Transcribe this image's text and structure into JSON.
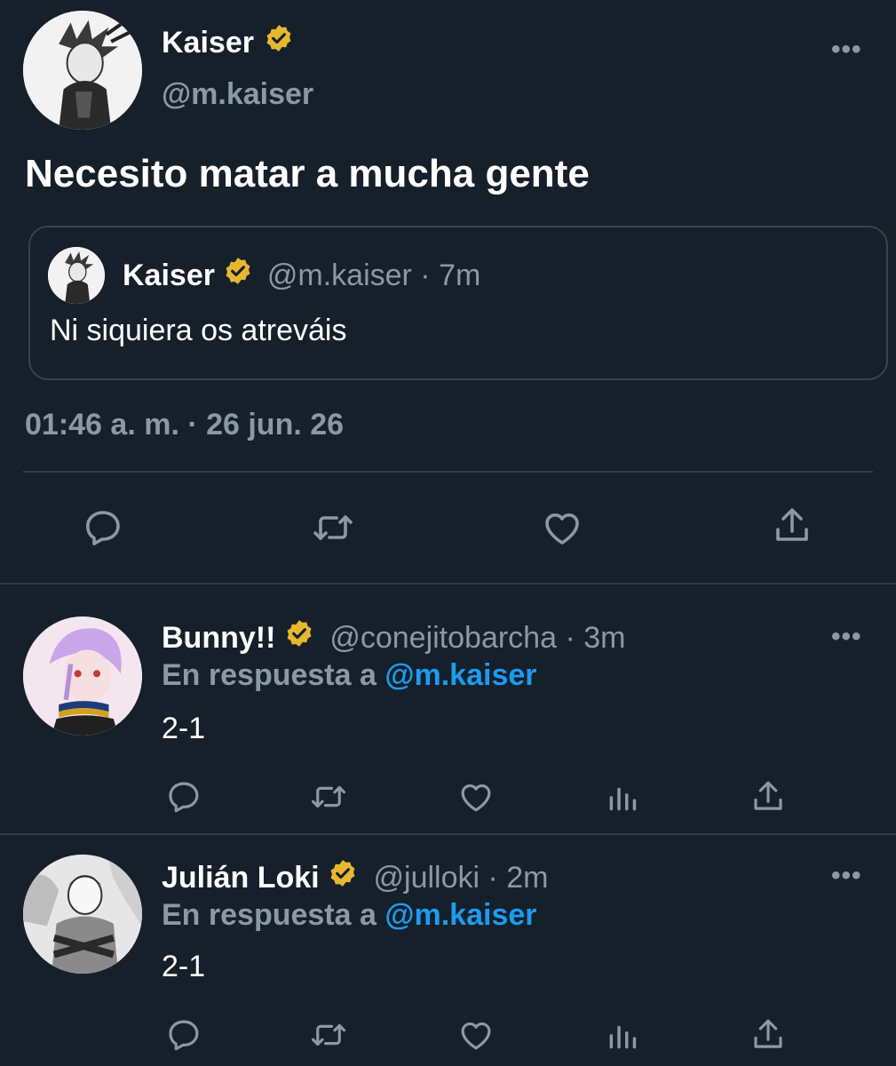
{
  "main_tweet": {
    "author_name": "Kaiser",
    "author_handle": "@m.kaiser",
    "text": "Necesito matar a mucha gente",
    "timestamp": "01:46 a. m. · 26 jun. 26",
    "more_icon": "more-horizontal-icon"
  },
  "quoted_tweet": {
    "author_name": "Kaiser",
    "handle_time": "@m.kaiser · 7m",
    "text": "Ni siquiera os atreváis"
  },
  "main_actions": [
    "reply-icon",
    "retweet-icon",
    "like-icon",
    "share-icon"
  ],
  "replies": [
    {
      "author_name": "Bunny!!",
      "handle_time": "@conejitobarcha · 3m",
      "reply_prefix": "En respuesta a",
      "reply_to": "@m.kaiser",
      "text": "2-1",
      "actions": [
        "reply-icon",
        "retweet-icon",
        "like-icon",
        "analytics-icon",
        "share-icon"
      ]
    },
    {
      "author_name": "Julián Loki",
      "handle_time": "@julloki · 2m",
      "reply_prefix": "En respuesta a",
      "reply_to": "@m.kaiser",
      "text": "2-1",
      "actions": [
        "reply-icon",
        "retweet-icon",
        "like-icon",
        "analytics-icon",
        "share-icon"
      ]
    }
  ],
  "colors": {
    "background": "#15202b",
    "text": "#ffffff",
    "muted": "#8b98a5",
    "link": "#1d9bf0",
    "verified": "#e8b72f",
    "divider": "#2f3b47"
  }
}
